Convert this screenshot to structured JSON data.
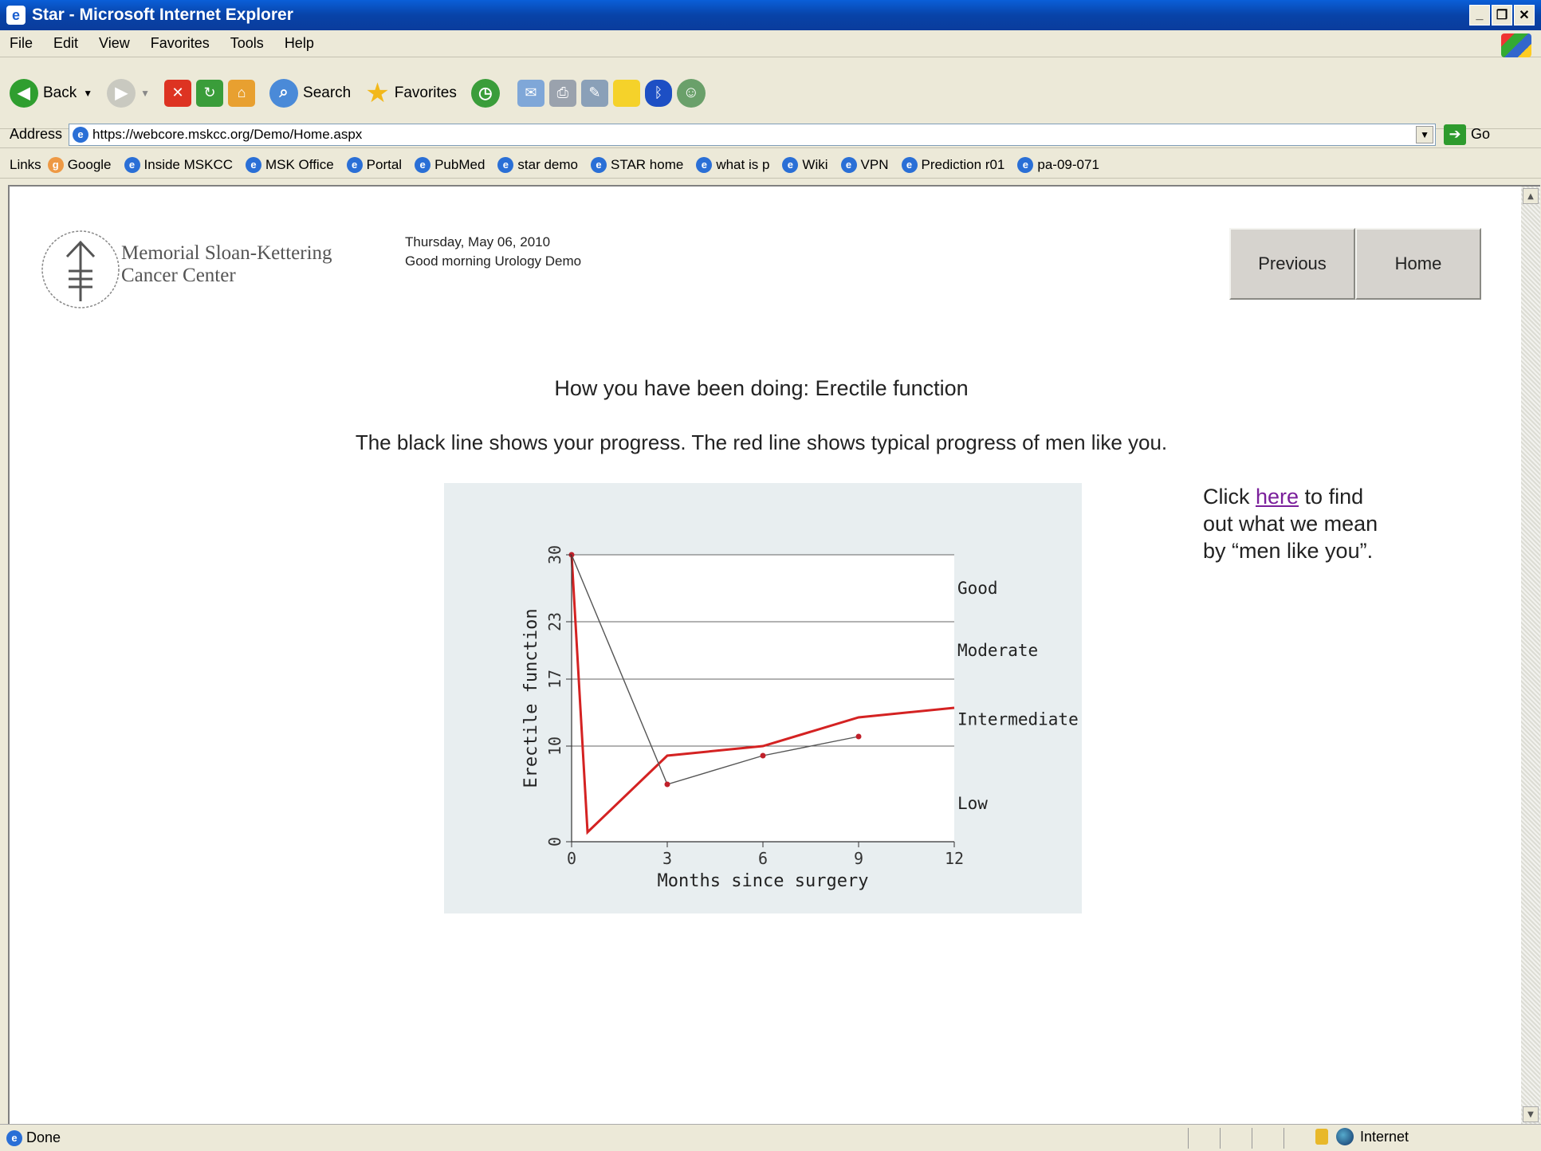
{
  "window": {
    "title": "Star - Microsoft Internet Explorer"
  },
  "menu": [
    "File",
    "Edit",
    "View",
    "Favorites",
    "Tools",
    "Help"
  ],
  "toolbar": {
    "back": "Back",
    "search": "Search",
    "favorites": "Favorites"
  },
  "address": {
    "label": "Address",
    "url": "https://webcore.mskcc.org/Demo/Home.aspx",
    "go": "Go"
  },
  "links": {
    "label": "Links",
    "items": [
      "Google",
      "Inside MSKCC",
      "MSK Office",
      "Portal",
      "PubMed",
      "star demo",
      "STAR home",
      "what is p",
      "Wiki",
      "VPN",
      "Prediction r01",
      "pa-09-071"
    ]
  },
  "page": {
    "logo_line1": "Memorial Sloan-Kettering",
    "logo_line2": "Cancer Center",
    "date": "Thursday, May 06, 2010",
    "greeting": "Good morning Urology Demo",
    "previous": "Previous",
    "home": "Home",
    "heading": "How you have been doing: Erectile function",
    "subheading": "The black line shows your progress. The red line shows typical progress of men like you.",
    "note_before": "Click ",
    "note_link": "here",
    "note_after": " to find out what we mean by “men like you”."
  },
  "status": {
    "text": "Done",
    "zone": "Internet"
  },
  "chart_data": {
    "type": "line",
    "xlabel": "Months since surgery",
    "ylabel": "Erectile function",
    "xlim": [
      0,
      12
    ],
    "ylim": [
      0,
      30
    ],
    "xticks": [
      0,
      3,
      6,
      9,
      12
    ],
    "yticks": [
      0,
      10,
      17,
      23,
      30
    ],
    "bands": [
      {
        "label": "Good",
        "y": 26.5
      },
      {
        "label": "Moderate",
        "y": 20
      },
      {
        "label": "Intermediate",
        "y": 12.8
      },
      {
        "label": "Low",
        "y": 4
      }
    ],
    "series": [
      {
        "color": "#d42222",
        "x": [
          0,
          0.5,
          3,
          6,
          9,
          12
        ],
        "y": [
          30,
          1,
          9,
          10,
          13,
          14
        ]
      },
      {
        "color": "#555555",
        "x": [
          0,
          3,
          6,
          9
        ],
        "y": [
          30,
          6,
          9,
          11
        ],
        "markers": true
      }
    ]
  }
}
